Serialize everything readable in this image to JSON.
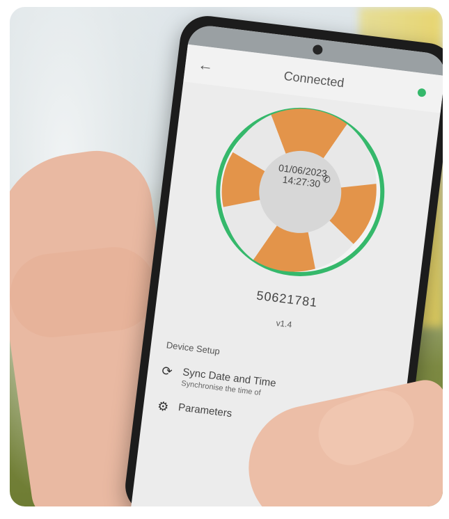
{
  "app": {
    "title": "Connected",
    "serial": "50621781",
    "version": "v1.4",
    "center": {
      "date": "01/06/2023",
      "time": "14:27:30"
    },
    "section_title": "Device Setup",
    "sync": {
      "title": "Sync Date and Time",
      "subtitle": "Synchronise the time of"
    },
    "params": {
      "title": "Parameters"
    }
  },
  "colors": {
    "accent_green": "#35b86b",
    "segment_orange": "#e3944a",
    "segment_gray": "#e8e8e8"
  }
}
